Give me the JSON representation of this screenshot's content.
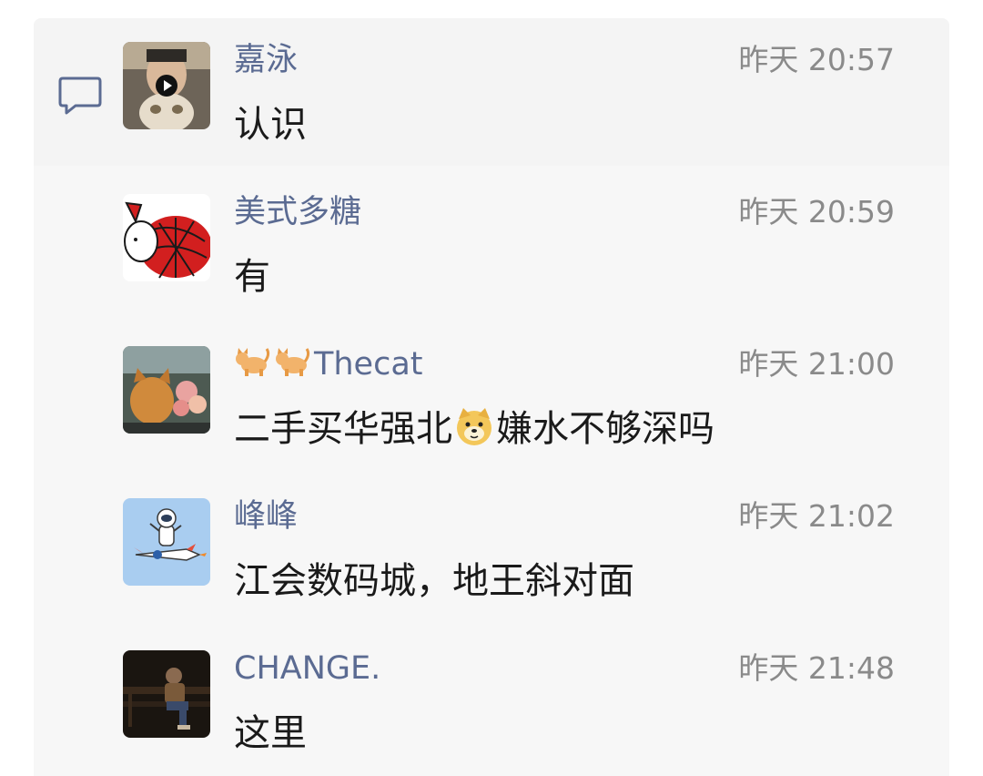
{
  "comments": [
    {
      "name": "嘉泳",
      "time": "昨天 20:57",
      "text": "认识",
      "avatar": "cat-face-photo-with-play-icon"
    },
    {
      "name": "美式多糖",
      "time": "昨天 20:59",
      "text": "有",
      "avatar": "spiderman-bunny"
    },
    {
      "name_prefix_icons": [
        "cat-emoji",
        "cat-emoji"
      ],
      "name": "Thecat",
      "time": "昨天 21:00",
      "text_before": "二手买华强北",
      "text_emoji": "doge-emoji",
      "text_after": "嫌水不够深吗",
      "avatar": "cat-with-flowers-photo"
    },
    {
      "name": "峰峰",
      "time": "昨天 21:02",
      "text": "江会数码城，地王斜对面",
      "avatar": "astronaut-on-rocket"
    },
    {
      "name": "CHANGE.",
      "time": "昨天 21:48",
      "text": "这里",
      "avatar": "person-sitting-dark-photo"
    }
  ],
  "icons": {
    "comment": "speech-bubble-icon"
  },
  "colors": {
    "name": "#5b6b92",
    "time": "#8a8a8a",
    "text": "#1a1a1a",
    "panel": "#f7f7f7",
    "icon": "#5b6b92"
  }
}
